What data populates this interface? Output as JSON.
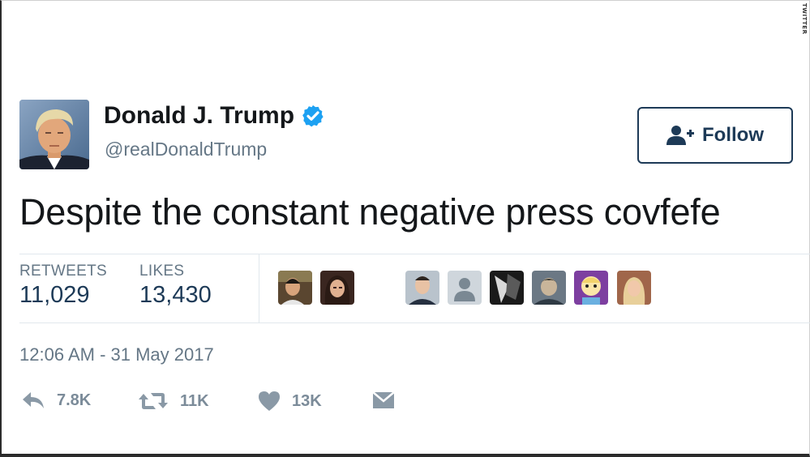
{
  "watermark": "TWITTER",
  "tweet": {
    "author_name": "Donald J. Trump",
    "handle": "@realDonaldTrump",
    "verified": true,
    "text": "Despite the constant negative press covfefe",
    "timestamp": "12:06 AM - 31 May 2017"
  },
  "follow_button": {
    "label": "Follow",
    "icon": "add-user-icon"
  },
  "stats": {
    "retweets_label": "RETWEETS",
    "retweets_value": "11,029",
    "likes_label": "LIKES",
    "likes_value": "13,430"
  },
  "likers": [
    {
      "name": "liker-avatar-1"
    },
    {
      "name": "liker-avatar-2"
    },
    {
      "name": "liker-avatar-3"
    },
    {
      "name": "liker-avatar-4"
    },
    {
      "name": "liker-avatar-5"
    },
    {
      "name": "liker-avatar-6"
    },
    {
      "name": "liker-avatar-7"
    },
    {
      "name": "liker-avatar-8"
    }
  ],
  "actions": {
    "reply_count": "7.8K",
    "retweet_count": "11K",
    "like_count": "13K"
  },
  "icons": {
    "verified": "verified-badge-icon",
    "reply": "reply-icon",
    "retweet": "retweet-icon",
    "like": "heart-icon",
    "message": "envelope-icon"
  },
  "colors": {
    "verified_blue": "#1da1f2",
    "follow_border": "#1d3a57",
    "stat_value": "#1d3a57",
    "secondary_text": "#657786",
    "action_gray": "#7b8b99"
  }
}
